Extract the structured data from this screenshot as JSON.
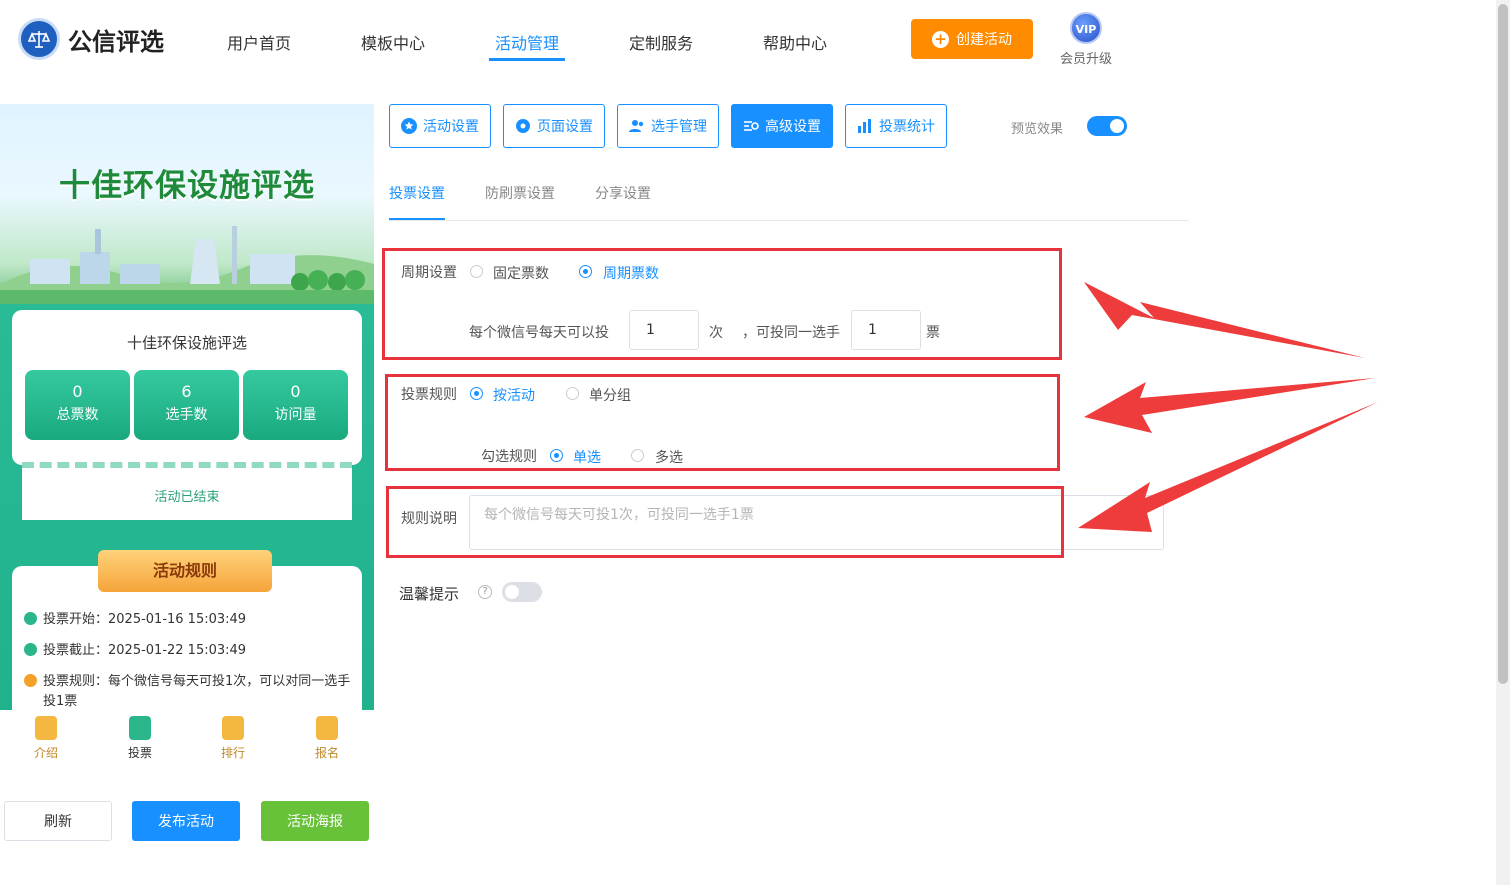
{
  "header": {
    "brand": "公信评选",
    "nav": [
      "用户首页",
      "模板中心",
      "活动管理",
      "定制服务",
      "帮助中心"
    ],
    "active_nav": "活动管理",
    "create_label": "创建活动",
    "vip_badge": "VIP",
    "vip_label": "会员升级"
  },
  "preview": {
    "banner_title": "十佳环保设施评选",
    "card_title": "十佳环保设施评选",
    "stats": [
      {
        "value": "0",
        "label": "总票数"
      },
      {
        "value": "6",
        "label": "选手数"
      },
      {
        "value": "0",
        "label": "访问量"
      }
    ],
    "status": "活动已结束",
    "rules_title": "活动规则",
    "rules": [
      {
        "text": "投票开始：2025-01-16 15:03:49",
        "color": "#2bb58a"
      },
      {
        "text": "投票截止：2025-01-22 15:03:49",
        "color": "#2bb58a"
      },
      {
        "text": "投票规则：每个微信号每天可投1次，可以对同一选手投1票",
        "color": "#f4a12a"
      }
    ],
    "tabs": [
      "介绍",
      "投票",
      "排行",
      "报名"
    ],
    "active_tab": "投票"
  },
  "bottom_buttons": {
    "refresh": "刷新",
    "publish": "发布活动",
    "poster": "活动海报"
  },
  "toolbar": {
    "buttons": [
      "活动设置",
      "页面设置",
      "选手管理",
      "高级设置",
      "投票统计"
    ],
    "active": "高级设置",
    "preview_label": "预览效果",
    "preview_on": true
  },
  "subtabs": {
    "items": [
      "投票设置",
      "防刷票设置",
      "分享设置"
    ],
    "active": "投票设置"
  },
  "form": {
    "period_label": "周期设置",
    "period_options": [
      "固定票数",
      "周期票数"
    ],
    "period_selected": "周期票数",
    "daily_prefix": "每个微信号每天可以投",
    "daily_votes": "1",
    "times_unit": "次",
    "same_player_text": "，可投同一选手",
    "same_player_votes": "1",
    "votes_unit": "票",
    "rule_label": "投票规则",
    "rule_options": [
      "按活动",
      "单分组"
    ],
    "rule_selected": "按活动",
    "check_label": "勾选规则",
    "check_options": [
      "单选",
      "多选"
    ],
    "check_selected": "单选",
    "desc_label": "规则说明",
    "desc_placeholder": "每个微信号每天可投1次，可投同一选手1票",
    "tip_label": "温馨提示",
    "tip_on": false
  },
  "colors": {
    "accent": "#1890ff",
    "orange": "#ff8c00",
    "green": "#67c23a",
    "highlight": "#e8323c"
  }
}
